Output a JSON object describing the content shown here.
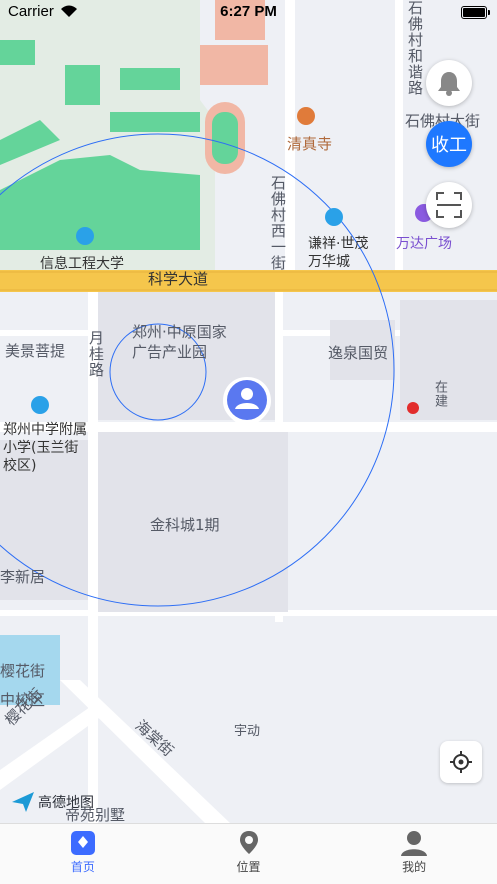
{
  "status_bar": {
    "carrier": "Carrier",
    "time": "6:27 PM"
  },
  "map": {
    "labels": {
      "shifocun_hezhu": "石佛村和谐路",
      "shifocun_dajie": "石佛村大街",
      "qingzhensi": "清真寺",
      "shifocun_xiyijie": "石佛村西一街",
      "qianxiang": "谦祥·世茂万华城",
      "wanda": "万达广场",
      "xinxi": "信息工程大学",
      "kexue": "科学大道",
      "zhongyuan": "郑州·中原国家广告产业园",
      "meijing": "美景菩提",
      "yuegui": "月桂路",
      "yiquan": "逸泉国贸",
      "zhengzhou_school": "郑州中学附属小学(玉兰街校区)",
      "jinkecheng": "金科城1期",
      "lixin": "李新居",
      "yinghua": "樱花街",
      "xiaoqu": "中校区",
      "yinghuajie": "樱花街",
      "haitang": "海棠街",
      "yudong": "宇动",
      "bieshu": "帝苑别墅",
      "jianjie": "在建"
    },
    "provider_logo_text": "高德地图"
  },
  "controls": {
    "bell_icon": "bell-icon",
    "clock_out_label": "收工",
    "scan_icon": "scan-icon",
    "locate_icon": "crosshair-icon"
  },
  "colors": {
    "accent": "#1e78ff",
    "tab_active": "#3c6bff",
    "main_road": "#f5c64c",
    "green": "#64d49a",
    "circle": "#2d6ef5"
  },
  "tabs": [
    {
      "label": "首页",
      "icon": "home-icon",
      "active": true
    },
    {
      "label": "位置",
      "icon": "location-icon",
      "active": false
    },
    {
      "label": "我的",
      "icon": "profile-icon",
      "active": false
    }
  ]
}
